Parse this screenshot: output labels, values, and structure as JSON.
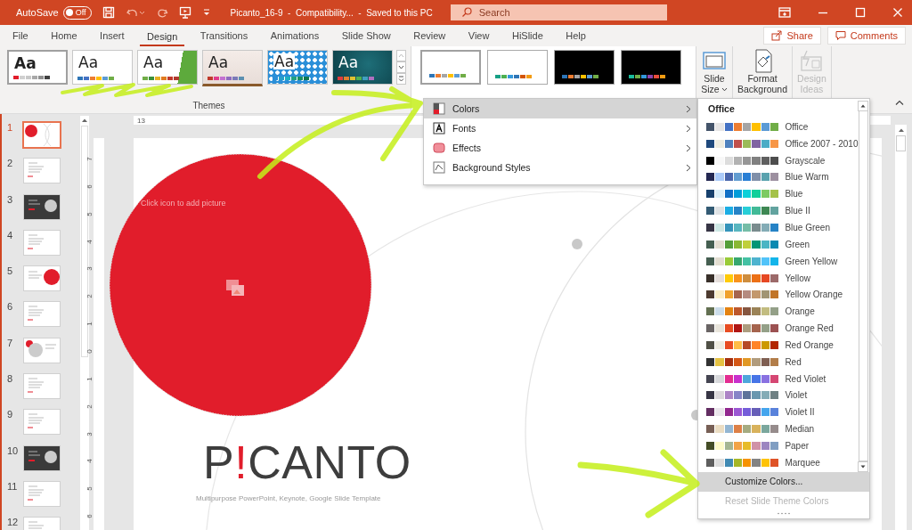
{
  "title_bar": {
    "autosave": {
      "label": "AutoSave",
      "on": false,
      "state_text": "Off"
    },
    "document_title": "Picanto_16-9  -  Compatibility...  -  Saved to this PC",
    "search": {
      "placeholder": "Search"
    }
  },
  "tabs": [
    {
      "label": "File",
      "selected": false
    },
    {
      "label": "Home",
      "selected": false
    },
    {
      "label": "Insert",
      "selected": false
    },
    {
      "label": "Design",
      "selected": true
    },
    {
      "label": "Transitions",
      "selected": false
    },
    {
      "label": "Animations",
      "selected": false
    },
    {
      "label": "Slide Show",
      "selected": false
    },
    {
      "label": "Review",
      "selected": false
    },
    {
      "label": "View",
      "selected": false
    },
    {
      "label": "HiSlide",
      "selected": false
    },
    {
      "label": "Help",
      "selected": false
    }
  ],
  "share_button": "Share",
  "comments_button": "Comments",
  "themes": {
    "label": "Themes",
    "items": [
      {
        "sample": "Aa",
        "kind": "white",
        "selected": true,
        "swatches": [
          {
            "color": "#e11d2b"
          },
          {
            "color": "#d0d0d0"
          },
          {
            "color": "#c8c8c8"
          },
          {
            "color": "#a8a8a8"
          },
          {
            "color": "#909090"
          },
          {
            "color": "#404040"
          }
        ]
      },
      {
        "sample": "Aa",
        "kind": "frame",
        "selected": false,
        "swatches": [
          {
            "color": "#2e75b6"
          },
          {
            "color": "#4472c4"
          },
          {
            "color": "#ed7d31"
          },
          {
            "color": "#ffc000"
          },
          {
            "color": "#5b9bd5"
          },
          {
            "color": "#70ad47"
          }
        ]
      },
      {
        "sample": "Aa",
        "kind": "green",
        "selected": false,
        "swatches": [
          {
            "color": "#70ad47"
          },
          {
            "color": "#3a8f3a"
          },
          {
            "color": "#e7b023"
          },
          {
            "color": "#e07a1f"
          },
          {
            "color": "#c0392b"
          },
          {
            "color": "#b03a2e"
          }
        ]
      },
      {
        "sample": "Aa",
        "kind": "beige",
        "selected": false,
        "swatches": [
          {
            "color": "#c0392b"
          },
          {
            "color": "#e03c8a"
          },
          {
            "color": "#c36fd0"
          },
          {
            "color": "#8e6bbf"
          },
          {
            "color": "#7a7ab8"
          },
          {
            "color": "#5b8fb0"
          }
        ]
      },
      {
        "sample": "Aa",
        "kind": "pattern",
        "selected": false,
        "swatches": [
          {
            "color": "#2a8fd8"
          },
          {
            "color": "#26a0c8"
          },
          {
            "color": "#1cb0c0"
          },
          {
            "color": "#20a080"
          },
          {
            "color": "#1a9060"
          },
          {
            "color": "#107850"
          }
        ]
      },
      {
        "sample": "Aa",
        "kind": "teal",
        "selected": false,
        "swatches": [
          {
            "color": "#e03c3c"
          },
          {
            "color": "#e08030"
          },
          {
            "color": "#e0c030"
          },
          {
            "color": "#50b050"
          },
          {
            "color": "#40a0c0"
          },
          {
            "color": "#b070c0"
          }
        ]
      }
    ]
  },
  "variants": [
    {
      "kind": "light",
      "selected": true,
      "swatches": [
        {
          "color": "#2e75b6"
        },
        {
          "color": "#ed7d31"
        },
        {
          "color": "#a5a5a5"
        },
        {
          "color": "#ffc000"
        },
        {
          "color": "#5b9bd5"
        },
        {
          "color": "#70ad47"
        }
      ]
    },
    {
      "kind": "light",
      "selected": false,
      "swatches": [
        {
          "color": "#16a085"
        },
        {
          "color": "#4cb050"
        },
        {
          "color": "#3498db"
        },
        {
          "color": "#2e75b6"
        },
        {
          "color": "#d35400"
        },
        {
          "color": "#f39c12"
        }
      ]
    },
    {
      "kind": "dark",
      "selected": false,
      "swatches": [
        {
          "color": "#2e75b6"
        },
        {
          "color": "#ed7d31"
        },
        {
          "color": "#a5a5a5"
        },
        {
          "color": "#ffc000"
        },
        {
          "color": "#5b9bd5"
        },
        {
          "color": "#70ad47"
        }
      ]
    },
    {
      "kind": "dark",
      "selected": false,
      "swatches": [
        {
          "color": "#1abc9c"
        },
        {
          "color": "#70ad47"
        },
        {
          "color": "#3498db"
        },
        {
          "color": "#8e44ad"
        },
        {
          "color": "#e74c3c"
        },
        {
          "color": "#f39c12"
        }
      ]
    }
  ],
  "ribbon_buttons": [
    {
      "kind": "slide-size",
      "lines": [
        "Slide",
        "Size"
      ],
      "caret": true,
      "disabled": false
    },
    {
      "kind": "format-background",
      "lines": [
        "Format",
        "Background"
      ],
      "caret": false,
      "disabled": false
    },
    {
      "kind": "design-ideas",
      "lines": [
        "Design",
        "Ideas"
      ],
      "caret": false,
      "disabled": true
    }
  ],
  "slides": [
    {
      "number": "1",
      "selected": true,
      "kind": "title"
    },
    {
      "number": "2",
      "selected": false,
      "kind": "light"
    },
    {
      "number": "3",
      "selected": false,
      "kind": "dark"
    },
    {
      "number": "4",
      "selected": false,
      "kind": "light"
    },
    {
      "number": "5",
      "selected": false,
      "kind": "accent"
    },
    {
      "number": "6",
      "selected": false,
      "kind": "light"
    },
    {
      "number": "7",
      "selected": false,
      "kind": "circles"
    },
    {
      "number": "8",
      "selected": false,
      "kind": "light"
    },
    {
      "number": "9",
      "selected": false,
      "kind": "light"
    },
    {
      "number": "10",
      "selected": false,
      "kind": "dark"
    },
    {
      "number": "11",
      "selected": false,
      "kind": "light"
    },
    {
      "number": "12",
      "selected": false,
      "kind": "light"
    }
  ],
  "rulers": {
    "horizontal": [
      "13"
    ],
    "vertical": [
      "7",
      "6",
      "5",
      "4",
      "3",
      "2",
      "1",
      "0",
      "1",
      "2",
      "3",
      "4",
      "5",
      "6"
    ]
  },
  "slide": {
    "placeholder_hint": "Click icon to add picture",
    "title_parts": [
      {
        "text": "P",
        "accent": false
      },
      {
        "text": "!",
        "accent": true
      },
      {
        "text": "CANTO",
        "accent": false
      }
    ],
    "subtitle": "Multipurpose PowerPoint, Keynote, Google Slide Template"
  },
  "design_menu": {
    "items": [
      {
        "label": "Colors",
        "kind": "colors",
        "selected": true
      },
      {
        "label": "Fonts",
        "kind": "fonts",
        "selected": false
      },
      {
        "label": "Effects",
        "kind": "effects",
        "selected": false
      },
      {
        "label": "Background Styles",
        "kind": "background",
        "selected": false
      }
    ]
  },
  "colors_submenu": {
    "header": "Office",
    "items": [
      {
        "name": "Office",
        "swatches": [
          {
            "color": "#44546a"
          },
          {
            "color": "#e7e6e6"
          },
          {
            "color": "#4472c4"
          },
          {
            "color": "#ed7d31"
          },
          {
            "color": "#a5a5a5"
          },
          {
            "color": "#ffc000"
          },
          {
            "color": "#5b9bd5"
          },
          {
            "color": "#70ad47"
          }
        ]
      },
      {
        "name": "Office 2007 - 2010",
        "swatches": [
          {
            "color": "#1f497d"
          },
          {
            "color": "#eeece1"
          },
          {
            "color": "#4f81bd"
          },
          {
            "color": "#c0504d"
          },
          {
            "color": "#9bbb59"
          },
          {
            "color": "#8064a2"
          },
          {
            "color": "#4bacc6"
          },
          {
            "color": "#f79646"
          }
        ]
      },
      {
        "name": "Grayscale",
        "swatches": [
          {
            "color": "#000000"
          },
          {
            "color": "#f8f8f8"
          },
          {
            "color": "#dddddd"
          },
          {
            "color": "#b2b2b2"
          },
          {
            "color": "#969696"
          },
          {
            "color": "#808080"
          },
          {
            "color": "#5f5f5f"
          },
          {
            "color": "#4d4d4d"
          }
        ]
      },
      {
        "name": "Blue Warm",
        "swatches": [
          {
            "color": "#242852"
          },
          {
            "color": "#accbf9"
          },
          {
            "color": "#4a66ac"
          },
          {
            "color": "#629dd1"
          },
          {
            "color": "#297fd5"
          },
          {
            "color": "#7f8fa9"
          },
          {
            "color": "#5aa2ae"
          },
          {
            "color": "#9d90a0"
          }
        ]
      },
      {
        "name": "Blue",
        "swatches": [
          {
            "color": "#17406d"
          },
          {
            "color": "#dbeff9"
          },
          {
            "color": "#0f6fc6"
          },
          {
            "color": "#009dd9"
          },
          {
            "color": "#0bd0d9"
          },
          {
            "color": "#10cf9b"
          },
          {
            "color": "#7cca62"
          },
          {
            "color": "#a5c249"
          }
        ]
      },
      {
        "name": "Blue II",
        "swatches": [
          {
            "color": "#335b74"
          },
          {
            "color": "#dfe3e5"
          },
          {
            "color": "#1cade4"
          },
          {
            "color": "#2683c6"
          },
          {
            "color": "#27ced7"
          },
          {
            "color": "#42ba97"
          },
          {
            "color": "#3e8853"
          },
          {
            "color": "#62a39f"
          }
        ]
      },
      {
        "name": "Blue Green",
        "swatches": [
          {
            "color": "#373545"
          },
          {
            "color": "#cee8e5"
          },
          {
            "color": "#3494ba"
          },
          {
            "color": "#58b6c0"
          },
          {
            "color": "#75bda7"
          },
          {
            "color": "#7a8c8e"
          },
          {
            "color": "#84acb6"
          },
          {
            "color": "#2683c6"
          }
        ]
      },
      {
        "name": "Green",
        "swatches": [
          {
            "color": "#455f51"
          },
          {
            "color": "#e3ded1"
          },
          {
            "color": "#549e39"
          },
          {
            "color": "#8ab833"
          },
          {
            "color": "#c0cf3a"
          },
          {
            "color": "#029676"
          },
          {
            "color": "#4ab5c4"
          },
          {
            "color": "#0989b1"
          }
        ]
      },
      {
        "name": "Green Yellow",
        "swatches": [
          {
            "color": "#455f51"
          },
          {
            "color": "#e3ded1"
          },
          {
            "color": "#99cb38"
          },
          {
            "color": "#37a76f"
          },
          {
            "color": "#44c1a3"
          },
          {
            "color": "#4eb3cf"
          },
          {
            "color": "#51c3f9"
          },
          {
            "color": "#13b5ea"
          }
        ]
      },
      {
        "name": "Yellow",
        "swatches": [
          {
            "color": "#39302a"
          },
          {
            "color": "#e5dedb"
          },
          {
            "color": "#ffca08"
          },
          {
            "color": "#f8931d"
          },
          {
            "color": "#ce8d3e"
          },
          {
            "color": "#ec7016"
          },
          {
            "color": "#e64823"
          },
          {
            "color": "#9c6a6a"
          }
        ]
      },
      {
        "name": "Yellow Orange",
        "swatches": [
          {
            "color": "#4e3b30"
          },
          {
            "color": "#fbeec9"
          },
          {
            "color": "#f0a22e"
          },
          {
            "color": "#a5644e"
          },
          {
            "color": "#b58b80"
          },
          {
            "color": "#c3986d"
          },
          {
            "color": "#a19574"
          },
          {
            "color": "#c17529"
          }
        ]
      },
      {
        "name": "Orange",
        "swatches": [
          {
            "color": "#637052"
          },
          {
            "color": "#ccddea"
          },
          {
            "color": "#e48312"
          },
          {
            "color": "#bd582c"
          },
          {
            "color": "#865640"
          },
          {
            "color": "#9b8357"
          },
          {
            "color": "#c2bc80"
          },
          {
            "color": "#94a088"
          }
        ]
      },
      {
        "name": "Orange Red",
        "swatches": [
          {
            "color": "#696464"
          },
          {
            "color": "#e9e5dc"
          },
          {
            "color": "#e84c22"
          },
          {
            "color": "#b01513"
          },
          {
            "color": "#ac9d7f"
          },
          {
            "color": "#a5644e"
          },
          {
            "color": "#94a088"
          },
          {
            "color": "#9c5252"
          }
        ]
      },
      {
        "name": "Red Orange",
        "swatches": [
          {
            "color": "#505046"
          },
          {
            "color": "#eeece1"
          },
          {
            "color": "#e84c22"
          },
          {
            "color": "#ffbd47"
          },
          {
            "color": "#b64926"
          },
          {
            "color": "#ff8427"
          },
          {
            "color": "#cc9900"
          },
          {
            "color": "#b22600"
          }
        ]
      },
      {
        "name": "Red",
        "swatches": [
          {
            "color": "#323232"
          },
          {
            "color": "#e5c243"
          },
          {
            "color": "#a5300f"
          },
          {
            "color": "#d55816"
          },
          {
            "color": "#e19825"
          },
          {
            "color": "#b19c7d"
          },
          {
            "color": "#7f5f52"
          },
          {
            "color": "#b27d49"
          }
        ]
      },
      {
        "name": "Red Violet",
        "swatches": [
          {
            "color": "#454551"
          },
          {
            "color": "#d8d9dc"
          },
          {
            "color": "#e32d91"
          },
          {
            "color": "#c830cc"
          },
          {
            "color": "#4ea6dc"
          },
          {
            "color": "#4775e7"
          },
          {
            "color": "#8971e1"
          },
          {
            "color": "#d54773"
          }
        ]
      },
      {
        "name": "Violet",
        "swatches": [
          {
            "color": "#373545"
          },
          {
            "color": "#dcd8dc"
          },
          {
            "color": "#ad84c6"
          },
          {
            "color": "#8784c7"
          },
          {
            "color": "#5d739a"
          },
          {
            "color": "#6997af"
          },
          {
            "color": "#84acb6"
          },
          {
            "color": "#6f8183"
          }
        ]
      },
      {
        "name": "Violet II",
        "swatches": [
          {
            "color": "#632e62"
          },
          {
            "color": "#eae5eb"
          },
          {
            "color": "#92278f"
          },
          {
            "color": "#9b57d3"
          },
          {
            "color": "#755dd9"
          },
          {
            "color": "#665eb8"
          },
          {
            "color": "#45a5ed"
          },
          {
            "color": "#5982db"
          }
        ]
      },
      {
        "name": "Median",
        "swatches": [
          {
            "color": "#775f55"
          },
          {
            "color": "#ebddc3"
          },
          {
            "color": "#94b6d2"
          },
          {
            "color": "#dd8047"
          },
          {
            "color": "#a5ab81"
          },
          {
            "color": "#d8b25c"
          },
          {
            "color": "#7ba79d"
          },
          {
            "color": "#968c8c"
          }
        ]
      },
      {
        "name": "Paper",
        "swatches": [
          {
            "color": "#444d26"
          },
          {
            "color": "#fefac9"
          },
          {
            "color": "#a5b592"
          },
          {
            "color": "#f3a447"
          },
          {
            "color": "#e7bc29"
          },
          {
            "color": "#d092a7"
          },
          {
            "color": "#9c85c0"
          },
          {
            "color": "#809ec2"
          }
        ]
      },
      {
        "name": "Marquee",
        "swatches": [
          {
            "color": "#5e5e5e"
          },
          {
            "color": "#dddddd"
          },
          {
            "color": "#418ab3"
          },
          {
            "color": "#a6b727"
          },
          {
            "color": "#f69200"
          },
          {
            "color": "#838383"
          },
          {
            "color": "#fec306"
          },
          {
            "color": "#df5327"
          }
        ]
      }
    ],
    "actions": [
      {
        "label": "Customize Colors...",
        "selected": true,
        "disabled": false
      },
      {
        "label": "Reset Slide Theme Colors",
        "selected": false,
        "disabled": true
      }
    ]
  }
}
